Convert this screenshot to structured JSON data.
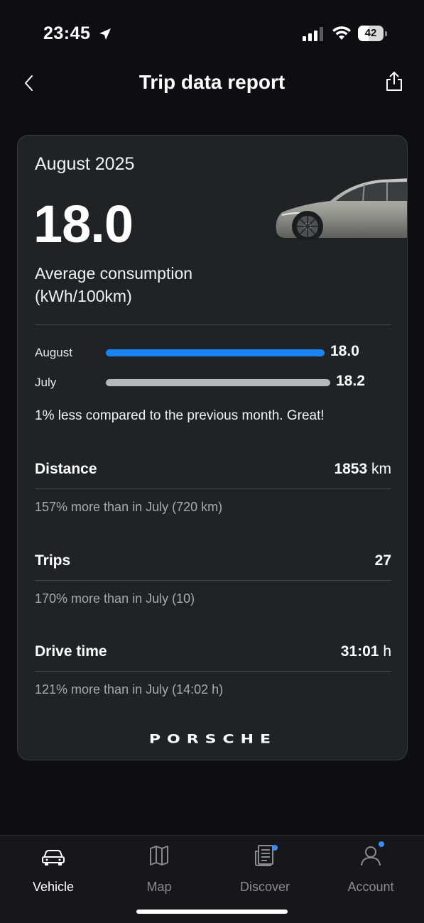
{
  "status_bar": {
    "time": "23:45",
    "battery_level": "42",
    "battery_percent": 42
  },
  "header": {
    "title": "Trip data report"
  },
  "report": {
    "month": "August 2025",
    "average_consumption": "18.0",
    "consumption_label": "Average consumption (kWh/100km)",
    "comparison_bars": [
      {
        "label": "August",
        "value": "18.0",
        "color": "#1a84f2"
      },
      {
        "label": "July",
        "value": "18.2",
        "color": "#b7b8bc"
      }
    ],
    "comparison_text": "1% less compared to the previous month. Great!",
    "stats": {
      "distance": {
        "label": "Distance",
        "value": "1853",
        "unit": "km",
        "note": "157% more than in July (720 km)"
      },
      "trips": {
        "label": "Trips",
        "value": "27",
        "unit": "",
        "note": "170% more than in July (10)"
      },
      "drive_time": {
        "label": "Drive time",
        "value": "31:01",
        "unit": "h",
        "note": "121% more than in July (14:02 h)"
      }
    },
    "brand": "PORSCHE"
  },
  "tab_bar": {
    "tabs": [
      {
        "label": "Vehicle",
        "icon": "car-icon",
        "active": true
      },
      {
        "label": "Map",
        "icon": "map-icon",
        "active": false
      },
      {
        "label": "Discover",
        "icon": "news-icon",
        "active": false,
        "badge": true
      },
      {
        "label": "Account",
        "icon": "person-icon",
        "active": false,
        "badge": true
      }
    ]
  },
  "colors": {
    "accent": "#1a84f2",
    "card": "#212226",
    "background": "#0e0e12"
  }
}
